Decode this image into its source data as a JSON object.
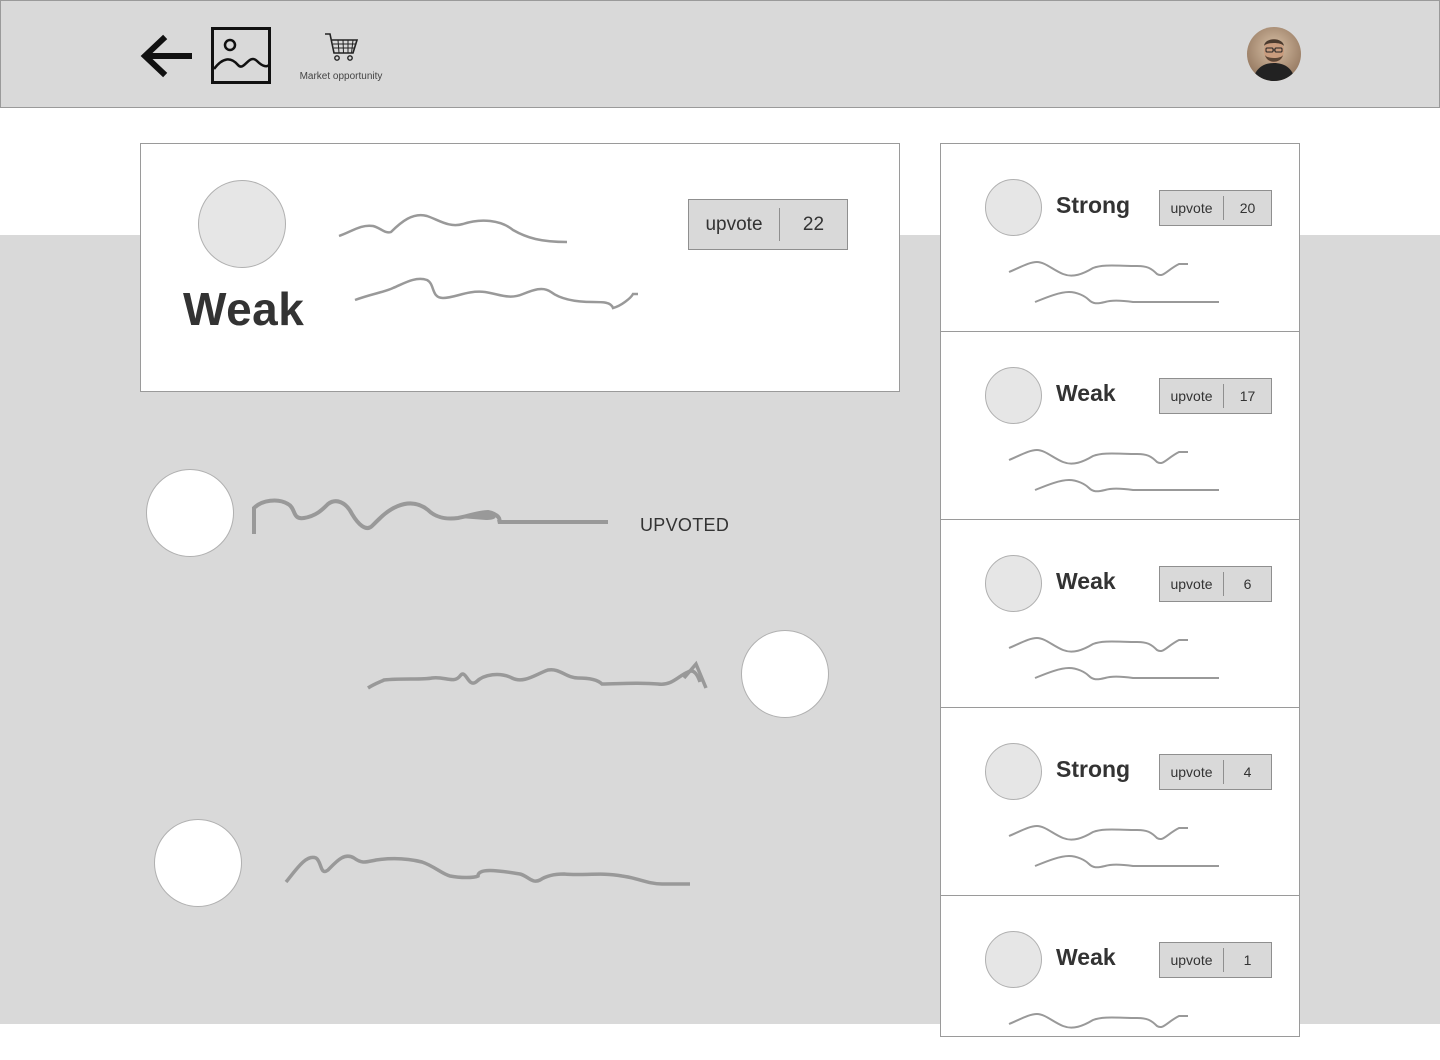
{
  "header": {
    "market_label": "Market opportunity",
    "icons": [
      "back-arrow-icon",
      "image-placeholder-icon",
      "cart-icon",
      "user-avatar"
    ]
  },
  "main_card": {
    "rating": "Weak",
    "upvote_label": "upvote",
    "upvote_count": "22"
  },
  "comments": {
    "upvoted_label": "UPVOTED"
  },
  "sidebar": {
    "cards": [
      {
        "rating": "Strong",
        "upvote_label": "upvote",
        "upvote_count": "20"
      },
      {
        "rating": "Weak",
        "upvote_label": "upvote",
        "upvote_count": "17"
      },
      {
        "rating": "Weak",
        "upvote_label": "upvote",
        "upvote_count": "6"
      },
      {
        "rating": "Strong",
        "upvote_label": "upvote",
        "upvote_count": "4"
      },
      {
        "rating": "Weak",
        "upvote_label": "upvote",
        "upvote_count": "1"
      }
    ]
  },
  "colors": {
    "background_gray": "#d9d9d9",
    "border": "#9a9a9a",
    "text": "#333333",
    "scribble": "#999999"
  }
}
